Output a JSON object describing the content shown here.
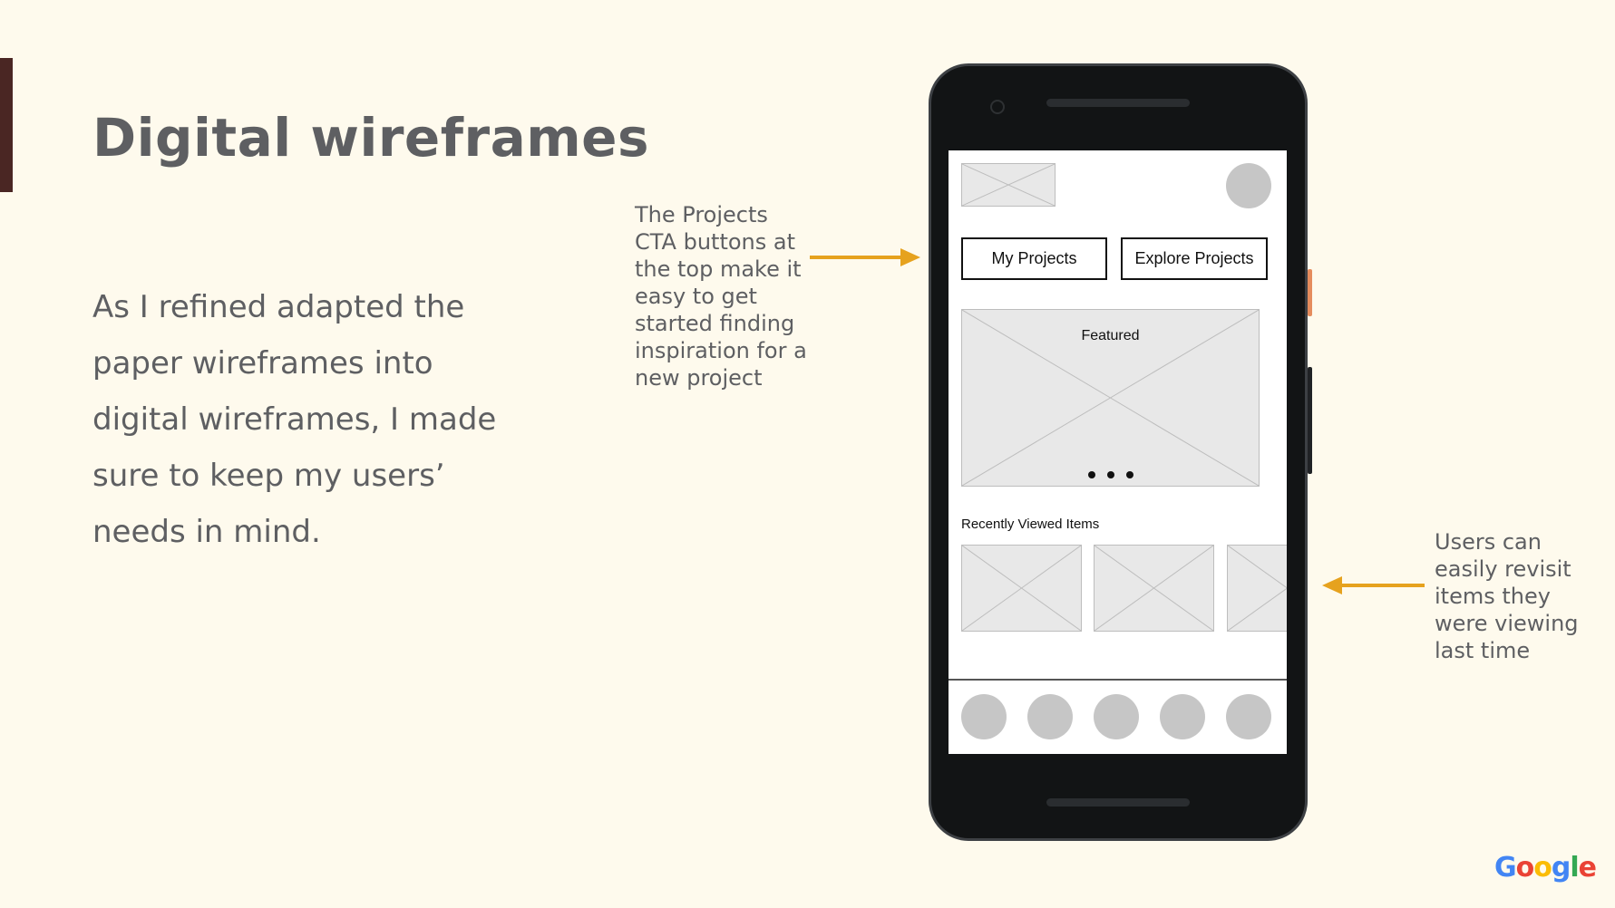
{
  "slide": {
    "title": "Digital wireframes",
    "body": "As I refined adapted the paper wireframes into digital wireframes, I made sure to keep my users’ needs in mind.",
    "annotation_top": "The Projects CTA buttons at the top make it easy to get started finding inspiration for a new project",
    "annotation_bottom": "Users can easily revisit items they were viewing last time",
    "accent_color": "#e6a21e",
    "background": "#fefaed"
  },
  "wireframe": {
    "cta_primary": "My Projects",
    "cta_secondary": "Explore Projects",
    "featured_label": "Featured",
    "recent_label": "Recently Viewed Items",
    "nav_item_count": 5
  },
  "brand": {
    "logo_letters": [
      "G",
      "o",
      "o",
      "g",
      "l",
      "e"
    ],
    "logo_colors": [
      "#4285f4",
      "#ea4335",
      "#fbbc05",
      "#4285f4",
      "#34a853",
      "#ea4335"
    ]
  }
}
